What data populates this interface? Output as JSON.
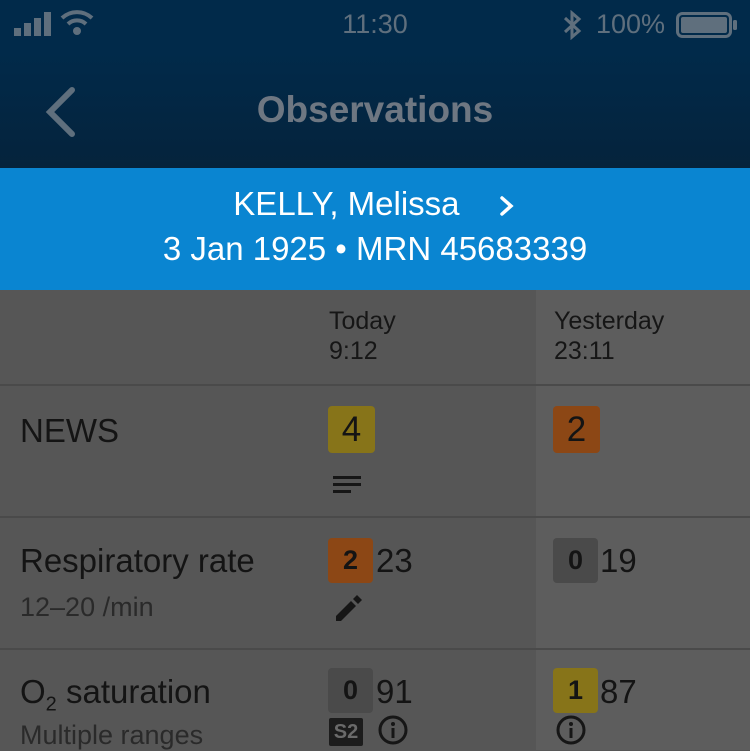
{
  "status_bar": {
    "time": "11:30",
    "battery": "100%"
  },
  "nav": {
    "title": "Observations"
  },
  "patient": {
    "name": "KELLY, Melissa",
    "info": "3 Jan 1925 • MRN 45683339"
  },
  "columns": [
    {
      "day": "Today",
      "time": "9:12"
    },
    {
      "day": "Yesterday",
      "time": "23:11"
    }
  ],
  "rows": [
    {
      "label": "NEWS",
      "today": {
        "score": "4"
      },
      "yesterday": {
        "score": "2"
      }
    },
    {
      "label": "Respiratory rate",
      "range": "12–20 /min",
      "today": {
        "score": "2",
        "value": "23"
      },
      "yesterday": {
        "score": "0",
        "value": "19"
      }
    },
    {
      "label_main": "O",
      "label_sub": "2",
      "label_rest": " saturation",
      "range": "Multiple ranges",
      "today": {
        "score": "0",
        "value": "91",
        "scale": "S2"
      },
      "yesterday": {
        "score": "1",
        "value": "87"
      }
    }
  ],
  "colors": {
    "status_bar": "#012a4a",
    "patient_banner": "#0a85d1",
    "badge_yellow": "#877419",
    "badge_orange": "#8c4715",
    "badge_grey": "#4a4a4a"
  }
}
